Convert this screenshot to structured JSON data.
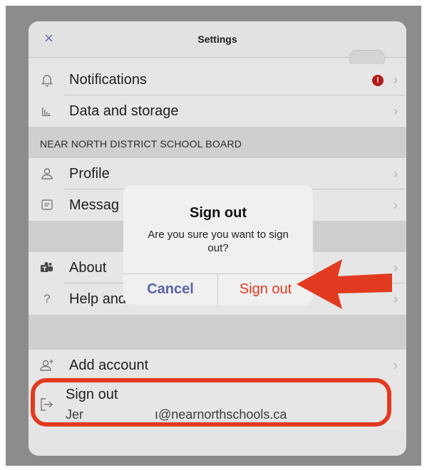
{
  "header": {
    "title": "Settings",
    "close_label": "×"
  },
  "rows": {
    "notifications": {
      "label": "Notifications",
      "badge": "!",
      "chevron": "›"
    },
    "data_storage": {
      "label": "Data and storage",
      "chevron": "›"
    },
    "profile": {
      "label": "Profile",
      "chevron": "›"
    },
    "messaging": {
      "label": "Messag",
      "chevron": "›"
    },
    "about": {
      "label": "About",
      "chevron": "›"
    },
    "help": {
      "label": "Help and",
      "chevron": "›"
    },
    "add_account": {
      "label": "Add account",
      "chevron": "›"
    }
  },
  "section": {
    "org_name": "NEAR NORTH DISTRICT SCHOOL BOARD"
  },
  "sign_out_row": {
    "title": "Sign out",
    "email_prefix": "Jer",
    "email_suffix": "ı@nearnorthschools.ca"
  },
  "dialog": {
    "title": "Sign out",
    "message": "Are you sure you want to sign out?",
    "cancel_label": "Cancel",
    "confirm_label": "Sign out"
  },
  "colors": {
    "accent": "#5c62a8",
    "danger": "#e23a20",
    "badge": "#b21a1a"
  },
  "icons": {
    "close": "close-icon",
    "notifications": "bell-icon",
    "data_storage": "bar-chart-icon",
    "profile": "person-icon",
    "messaging": "message-icon",
    "about": "teams-icon",
    "help": "question-icon",
    "add_account": "add-person-icon",
    "sign_out": "sign-out-icon"
  }
}
